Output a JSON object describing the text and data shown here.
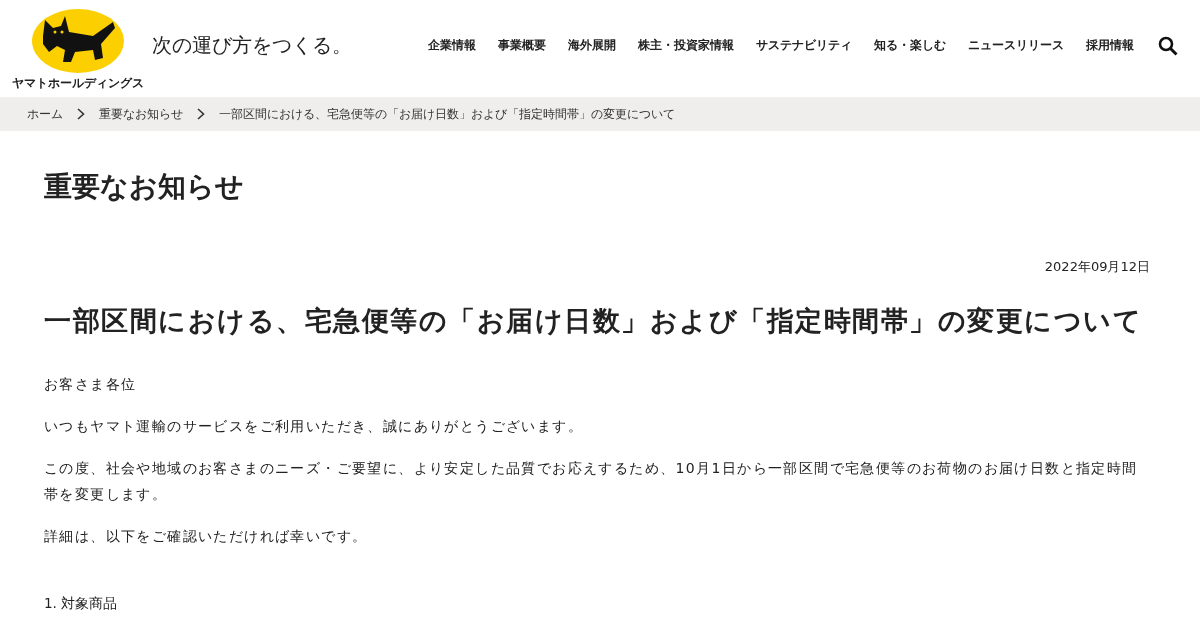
{
  "logo": {
    "caption": "ヤマトホールディングス"
  },
  "tagline": "次の運び方をつくる。",
  "nav": [
    "企業情報",
    "事業概要",
    "海外展開",
    "株主・投資家情報",
    "サステナビリティ",
    "知る・楽しむ",
    "ニュースリリース",
    "採用情報"
  ],
  "breadcrumb": [
    "ホーム",
    "重要なお知らせ",
    "一部区間における、宅急便等の「お届け日数」および「指定時間帯」の変更について"
  ],
  "section_title": "重要なお知らせ",
  "date": "2022年09月12日",
  "title": "一部区間における、宅急便等の「お届け日数」および「指定時間帯」の変更について",
  "paragraphs": [
    "お客さま各位",
    "いつもヤマト運輸のサービスをご利用いただき、誠にありがとうございます。",
    "この度、社会や地域のお客さまのニーズ・ご要望に、より安定した品質でお応えするため、10月1日から一部区間で宅急便等のお荷物のお届け日数と指定時間帯を変更します。",
    "詳細は、以下をご確認いただければ幸いです。"
  ],
  "list_heading": "1. 対象商品"
}
